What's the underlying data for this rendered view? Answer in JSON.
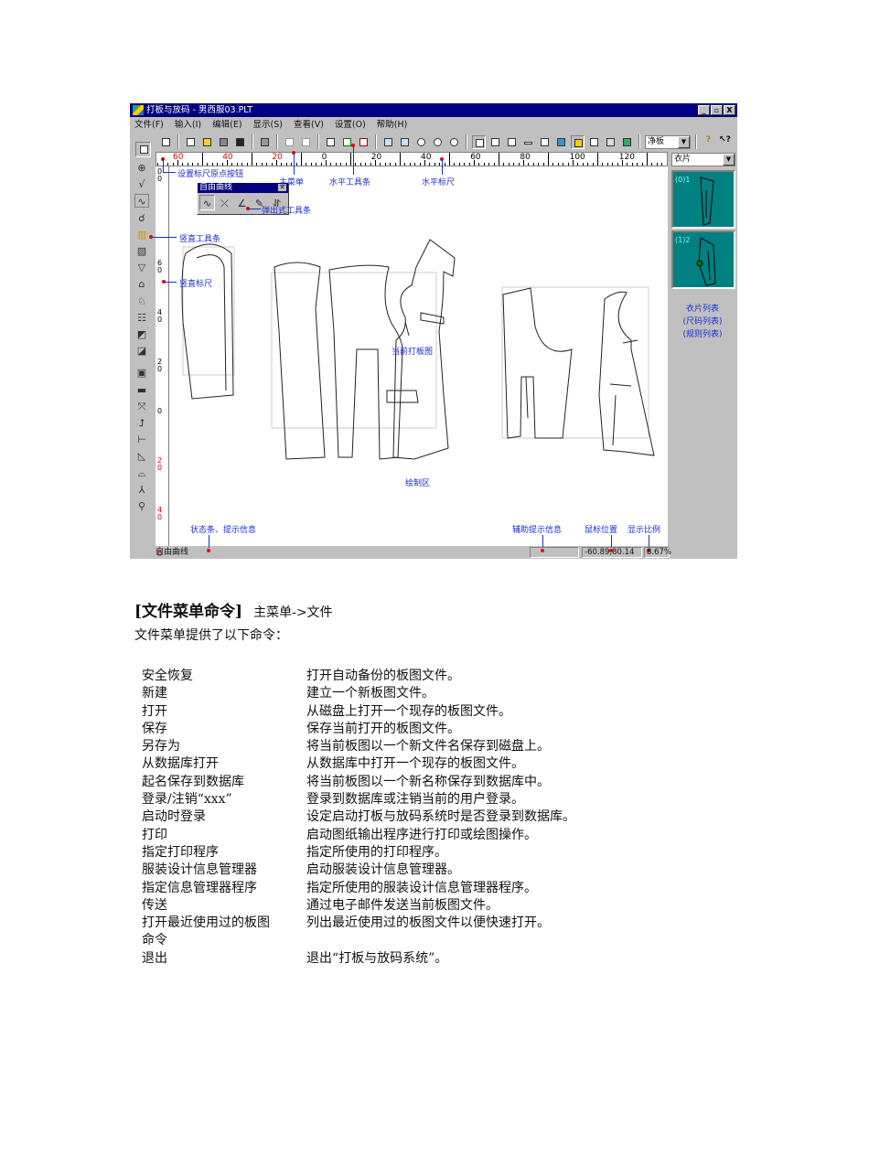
{
  "window": {
    "title": "打板与放码 - 男西服03.PLT",
    "buttons": [
      "_",
      "▫",
      "X"
    ]
  },
  "menu": [
    "文件(F)",
    "输入(I)",
    "编辑(E)",
    "显示(S)",
    "查看(V)",
    "设置(O)",
    "帮助(H)"
  ],
  "toolbar": {
    "mode_select": "净板",
    "piece_select": "衣片"
  },
  "hruler": [
    "60",
    "40",
    "20",
    "0",
    "20",
    "40",
    "60",
    "80",
    "100",
    "120"
  ],
  "vruler": [
    "0\n0",
    "6\n0",
    "4\n0",
    "2\n0",
    "0",
    "2\n0",
    "4\n0",
    "0"
  ],
  "popup": {
    "title": "自由曲线",
    "close": "✕"
  },
  "annotations": {
    "origin": "设置标尺原点按钮",
    "mainmenu": "主菜单",
    "htoolbar": "水平工具条",
    "hruler": "水平标尺",
    "popup": "弹出式工具条",
    "vtoolbar": "竖直工具条",
    "vruler": "竖直标尺",
    "current": "当前打板图",
    "draw": "绘制区",
    "status": "状态条、提示信息",
    "aux": "辅助提示信息",
    "mouse": "鼠标位置",
    "scale": "显示比例"
  },
  "panel": {
    "thumbs": [
      "(0)1",
      "(1)2"
    ],
    "labels": [
      "衣片列表",
      "(尺码列表)",
      "(规则列表)"
    ]
  },
  "status": {
    "text": "自由曲线",
    "aux": "",
    "mouse": "-60.89,80.14",
    "scale": "8.67%"
  },
  "doc": {
    "heading": "[文件菜单命令]",
    "path": "主菜单->文件",
    "intro": "文件菜单提供了以下命令：",
    "commands": [
      {
        "name": "安全恢复",
        "desc": "打开自动备份的板图文件。"
      },
      {
        "name": "新建",
        "desc": "建立一个新板图文件。"
      },
      {
        "name": "打开",
        "desc": "从磁盘上打开一个现存的板图文件。"
      },
      {
        "name": "保存",
        "desc": "保存当前打开的板图文件。"
      },
      {
        "name": "另存为",
        "desc": "将当前板图以一个新文件名保存到磁盘上。"
      },
      {
        "name": "从数据库打开",
        "desc": "从数据库中打开一个现存的板图文件。"
      },
      {
        "name": "起名保存到数据库",
        "desc": "将当前板图以一个新名称保存到数据库中。"
      },
      {
        "name": "登录/注销“xxx”",
        "desc": "登录到数据库或注销当前的用户登录。"
      },
      {
        "name": "启动时登录",
        "desc": "设定启动打板与放码系统时是否登录到数据库。"
      },
      {
        "name": "打印",
        "desc": "启动图纸输出程序进行打印或绘图操作。"
      },
      {
        "name": "指定打印程序",
        "desc": "指定所使用的打印程序。"
      },
      {
        "name": "服装设计信息管理器",
        "desc": "启动服装设计信息管理器。"
      },
      {
        "name": "指定信息管理器程序",
        "desc": "指定所使用的服装设计信息管理器程序。"
      },
      {
        "name": "传送",
        "desc": "通过电子邮件发送当前板图文件。"
      },
      {
        "name": "打开最近使用过的板图命令",
        "desc": "列出最近使用过的板图文件以便快速打开。"
      },
      {
        "name": "退出",
        "desc": "退出“打板与放码系统”。"
      }
    ]
  }
}
